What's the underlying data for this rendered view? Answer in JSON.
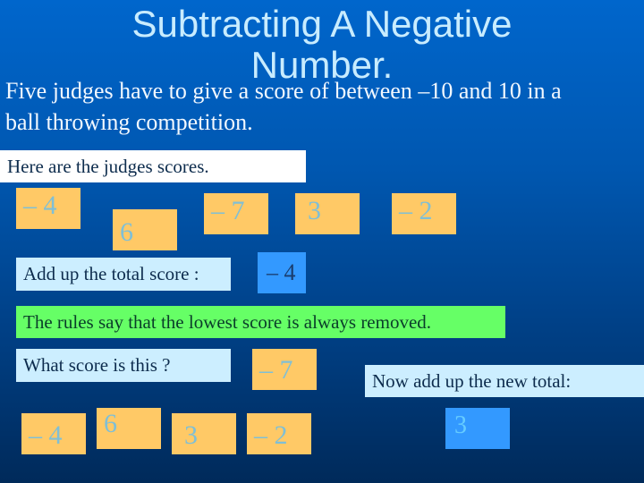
{
  "slide": {
    "title_line1": "Subtracting A Negative",
    "title_line2": "Number.",
    "intro_line1": "Five judges have to give a score of between –10 and 10 in a",
    "intro_line2": "ball throwing competition.",
    "judges_label": "Here are the judges scores.",
    "judge_scores": [
      "– 4",
      "6",
      "– 7",
      "3",
      "– 2"
    ],
    "add_total_label": "Add up the total score :",
    "total_score": "– 4",
    "rule_text": "The rules say that the lowest  score is always removed.",
    "question_label": "What score is this ?",
    "lowest_score": "– 7",
    "remaining_scores": [
      "– 4",
      "6",
      "3",
      "– 2"
    ],
    "new_total_label": "Now add up the new total:",
    "new_total": "3"
  },
  "colors": {
    "score_box": "#ffc966",
    "total_box": "#3399ff",
    "rule_box": "#66ff66",
    "label_box": "#cceeff"
  }
}
